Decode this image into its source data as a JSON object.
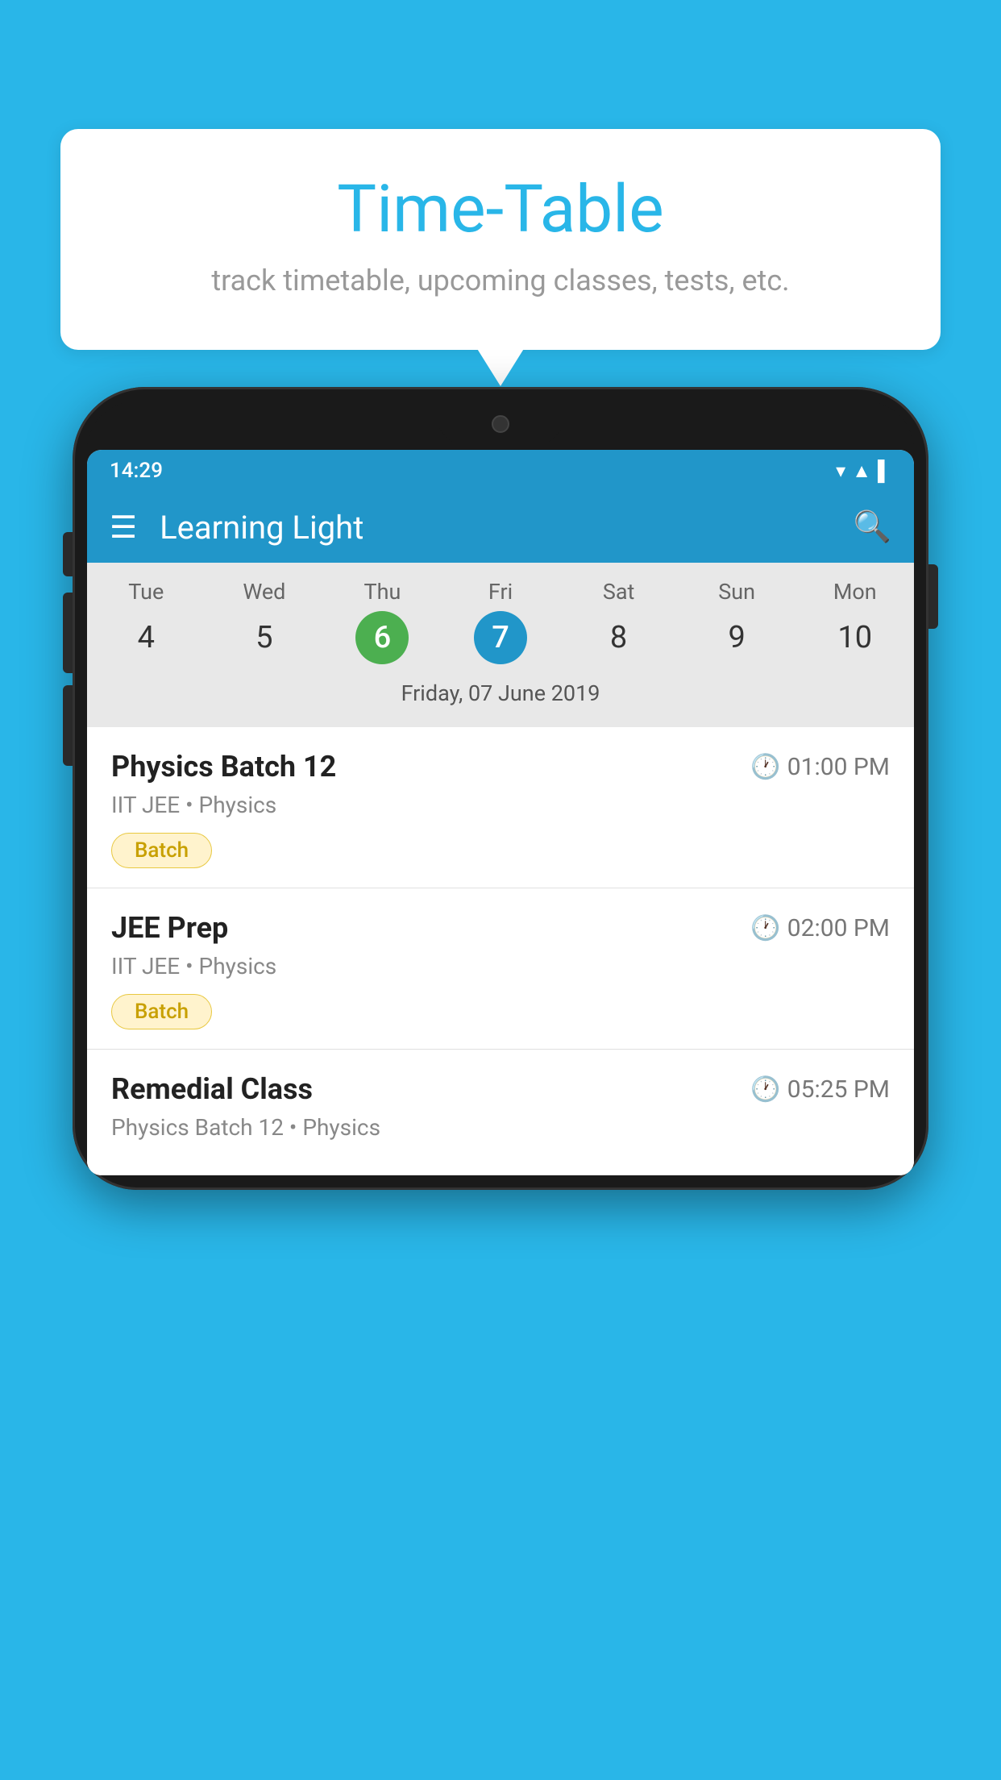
{
  "background_color": "#29b6e8",
  "bubble": {
    "title": "Time-Table",
    "subtitle": "track timetable, upcoming classes, tests, etc."
  },
  "phone": {
    "status_bar": {
      "time": "14:29"
    },
    "app_bar": {
      "title": "Learning Light"
    },
    "calendar": {
      "days": [
        {
          "name": "Tue",
          "num": "4",
          "state": "normal"
        },
        {
          "name": "Wed",
          "num": "5",
          "state": "normal"
        },
        {
          "name": "Thu",
          "num": "6",
          "state": "today"
        },
        {
          "name": "Fri",
          "num": "7",
          "state": "selected"
        },
        {
          "name": "Sat",
          "num": "8",
          "state": "normal"
        },
        {
          "name": "Sun",
          "num": "9",
          "state": "normal"
        },
        {
          "name": "Mon",
          "num": "10",
          "state": "normal"
        }
      ],
      "selected_date_label": "Friday, 07 June 2019"
    },
    "schedule": [
      {
        "title": "Physics Batch 12",
        "time": "01:00 PM",
        "subtitle": "IIT JEE • Physics",
        "badge": "Batch"
      },
      {
        "title": "JEE Prep",
        "time": "02:00 PM",
        "subtitle": "IIT JEE • Physics",
        "badge": "Batch"
      },
      {
        "title": "Remedial Class",
        "time": "05:25 PM",
        "subtitle": "Physics Batch 12 • Physics",
        "badge": null
      }
    ]
  }
}
